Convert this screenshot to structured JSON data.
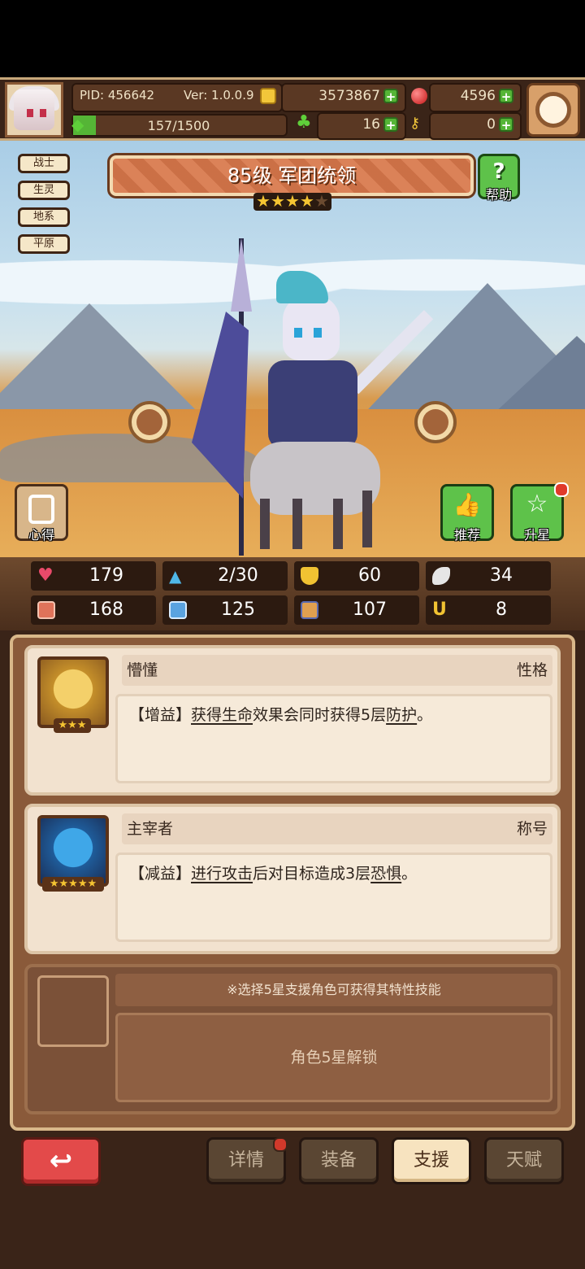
{
  "header": {
    "pid": "PID: 456642",
    "version": "Ver: 1.0.0.9",
    "gold": "3573867",
    "gems": "4596",
    "exp": "157/1500",
    "clover": "16",
    "keys": "0"
  },
  "hero": {
    "title": "85级 军团统领",
    "stars": 4,
    "max_stars": 5,
    "tags": [
      "战士",
      "生灵",
      "地系",
      "平原"
    ],
    "help_label": "帮助",
    "notes_label": "心得",
    "recommend_label": "推荐",
    "star_up_label": "升星"
  },
  "stats": [
    {
      "icon": "heart-icon",
      "value": "179",
      "color": "#e94a6a"
    },
    {
      "icon": "mana-drop-icon",
      "value": "2/30",
      "color": "#4fb7e8"
    },
    {
      "icon": "shield-icon",
      "value": "60",
      "color": "#f1c232"
    },
    {
      "icon": "wing-icon",
      "value": "34",
      "color": "#e6e6e6"
    },
    {
      "icon": "fist-icon",
      "value": "168",
      "color": "#e0735a"
    },
    {
      "icon": "spellbook-icon",
      "value": "125",
      "color": "#5aa3e0"
    },
    {
      "icon": "boots-icon",
      "value": "107",
      "color": "#e0a050"
    },
    {
      "icon": "horseshoe-icon",
      "value": "8",
      "color": "#f1c232"
    }
  ],
  "support": [
    {
      "name": "懵懂",
      "type": "性格",
      "stars": "★★★",
      "desc_prefix": "【增益】",
      "desc_link1": "获得生命",
      "desc_mid": "效果会同时获得5层",
      "desc_link2": "防护",
      "desc_suffix": "。"
    },
    {
      "name": "主宰者",
      "type": "称号",
      "stars": "★★★★★",
      "desc_prefix": "【减益】",
      "desc_link1": "进行攻击",
      "desc_mid": "后对目标造成3层",
      "desc_link2": "恐惧",
      "desc_suffix": "。"
    }
  ],
  "locked": {
    "hint": "※选择5星支援角色可获得其特性技能",
    "text": "角色5星解锁"
  },
  "nav": {
    "details": "详情",
    "equipment": "装备",
    "support": "支援",
    "talent": "天赋"
  },
  "colors": {
    "accent": "#d8774a",
    "plus_green": "#55b536",
    "back_red": "#e34a4a"
  }
}
